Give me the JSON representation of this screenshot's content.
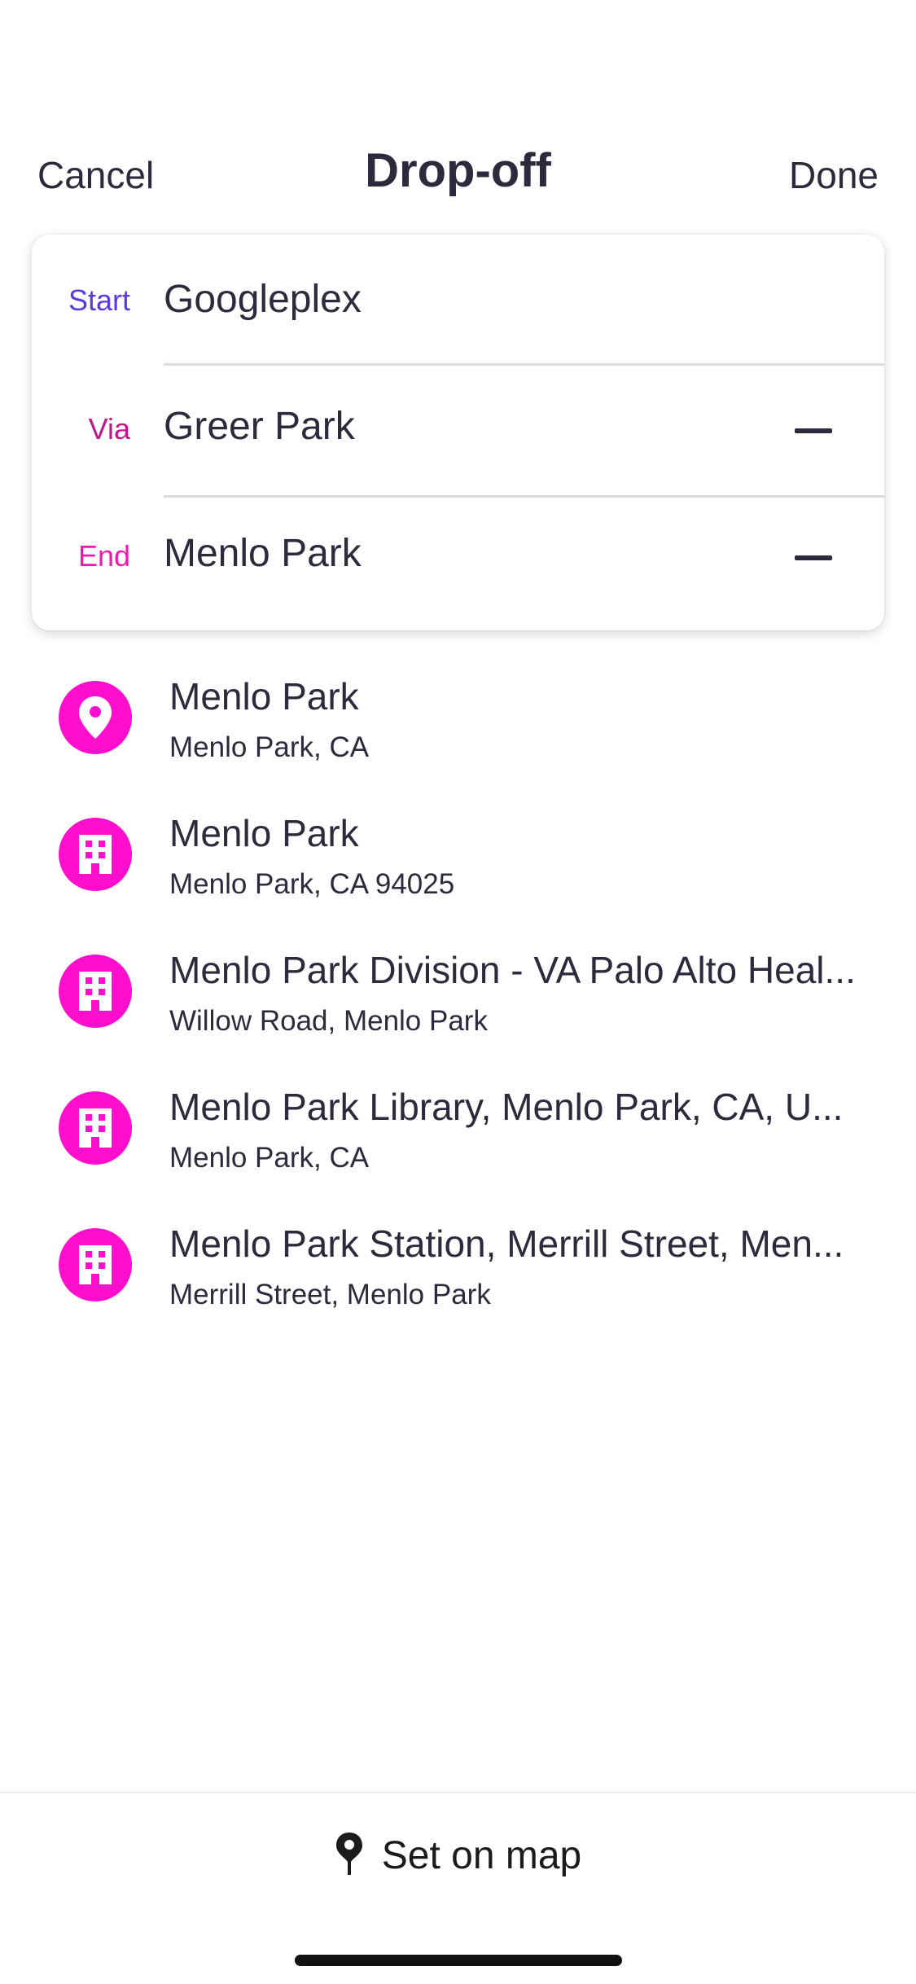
{
  "nav": {
    "cancel_label": "Cancel",
    "title": "Drop-off",
    "done_label": "Done"
  },
  "route": {
    "stops": [
      {
        "label": "Start",
        "value": "Googleplex",
        "label_color": "#5b3bdc"
      },
      {
        "label": "Via",
        "value": "Greer Park",
        "label_color": "#c0168d"
      },
      {
        "label": "End",
        "value": "Menlo Park",
        "label_color": "#ee1ab0"
      }
    ]
  },
  "results": [
    {
      "title": "Menlo Park",
      "subtitle": "Menlo Park, CA",
      "icon": "location-pin-icon"
    },
    {
      "title": "Menlo Park",
      "subtitle": "Menlo Park, CA 94025",
      "icon": "building-icon"
    },
    {
      "title": "Menlo Park Division - VA Palo Alto Heal...",
      "subtitle": "Willow Road, Menlo Park",
      "icon": "building-icon"
    },
    {
      "title": "Menlo Park Library, Menlo Park, CA, U...",
      "subtitle": "Menlo Park, CA",
      "icon": "building-icon"
    },
    {
      "title": "Menlo Park Station, Merrill Street, Men...",
      "subtitle": "Merrill Street, Menlo Park",
      "icon": "building-icon"
    }
  ],
  "footer": {
    "set_on_map_label": "Set on map",
    "icon": "map-pin-icon"
  },
  "colors": {
    "accent": "#ff0fcd",
    "text": "#2b2b3d"
  }
}
